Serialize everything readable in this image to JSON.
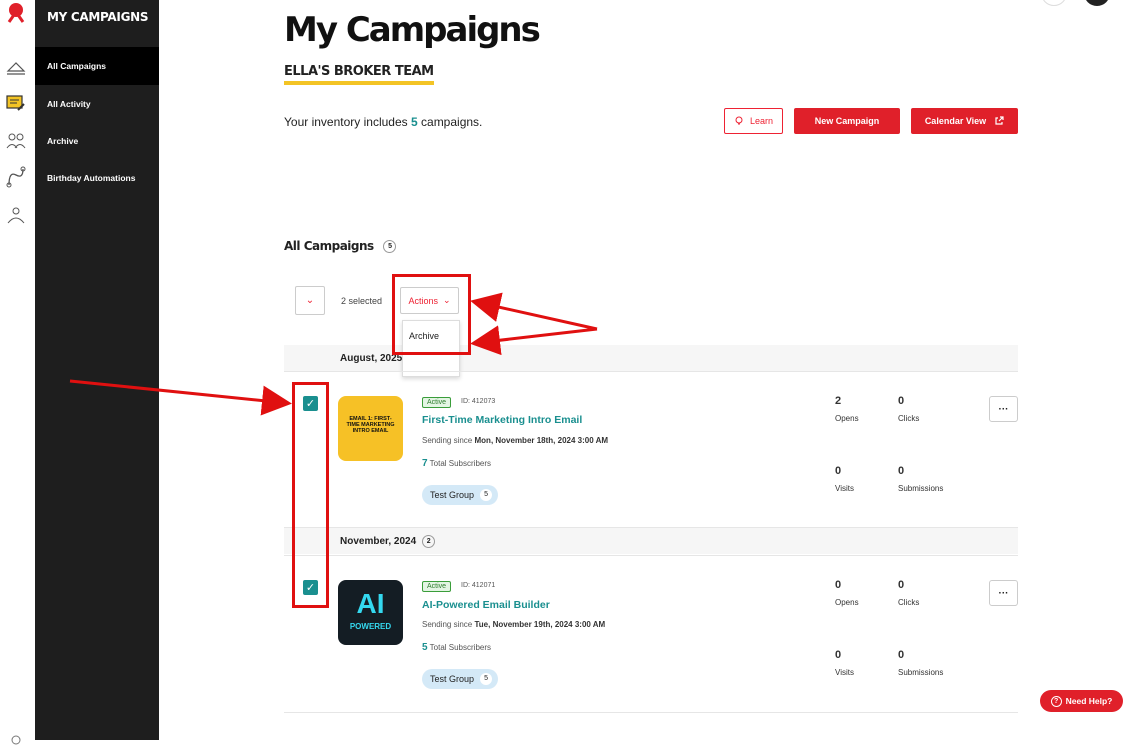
{
  "sidebar": {
    "title": "MY CAMPAIGNS",
    "items": [
      {
        "label": "All Campaigns"
      },
      {
        "label": "All Activity"
      },
      {
        "label": "Archive"
      },
      {
        "label": "Birthday Automations"
      }
    ]
  },
  "header": {
    "title": "My Campaigns",
    "team": "ELLA'S BROKER TEAM",
    "inventory_prefix": "Your inventory includes",
    "inventory_count": "5",
    "inventory_suffix": "campaigns."
  },
  "buttons": {
    "learn": "Learn",
    "new_campaign": "New Campaign",
    "calendar_view": "Calendar View"
  },
  "list": {
    "heading": "All Campaigns",
    "count": "5",
    "selected_text": "2 selected",
    "actions_label": "Actions",
    "action_options": [
      "Archive"
    ]
  },
  "groups": [
    {
      "label": "August, 2025",
      "campaign": {
        "status": "Active",
        "id": "ID: 412073",
        "name": "First-Time Marketing Intro Email",
        "sending_prefix": "Sending since",
        "sending_date": "Mon, November 18th, 2024 3:00 AM",
        "subscribers": "7",
        "subscribers_label": "Total Subscribers",
        "tag": "Test Group",
        "tag_count": "5",
        "thumb_text": "EMAIL 1: FIRST-TIME MARKETING INTRO EMAIL",
        "opens": "2",
        "clicks": "0",
        "visits": "0",
        "submissions": "0"
      }
    },
    {
      "label": "November, 2024",
      "count": "2",
      "campaign": {
        "status": "Active",
        "id": "ID: 412071",
        "name": "AI-Powered Email Builder",
        "sending_prefix": "Sending since",
        "sending_date": "Tue, November 19th, 2024 3:00 AM",
        "subscribers": "5",
        "subscribers_label": "Total Subscribers",
        "tag": "Test Group",
        "tag_count": "5",
        "thumb_text_1": "AI",
        "thumb_text_2": "POWERED",
        "opens": "0",
        "clicks": "0",
        "visits": "0",
        "submissions": "0"
      }
    }
  ],
  "stat_labels": {
    "opens": "Opens",
    "clicks": "Clicks",
    "visits": "Visits",
    "submissions": "Submissions"
  },
  "help": "Need Help?",
  "colors": {
    "accent": "#e0202a",
    "teal": "#1a8f8f",
    "sidebar": "#1e1e1e",
    "highlight": "#f3c425"
  }
}
